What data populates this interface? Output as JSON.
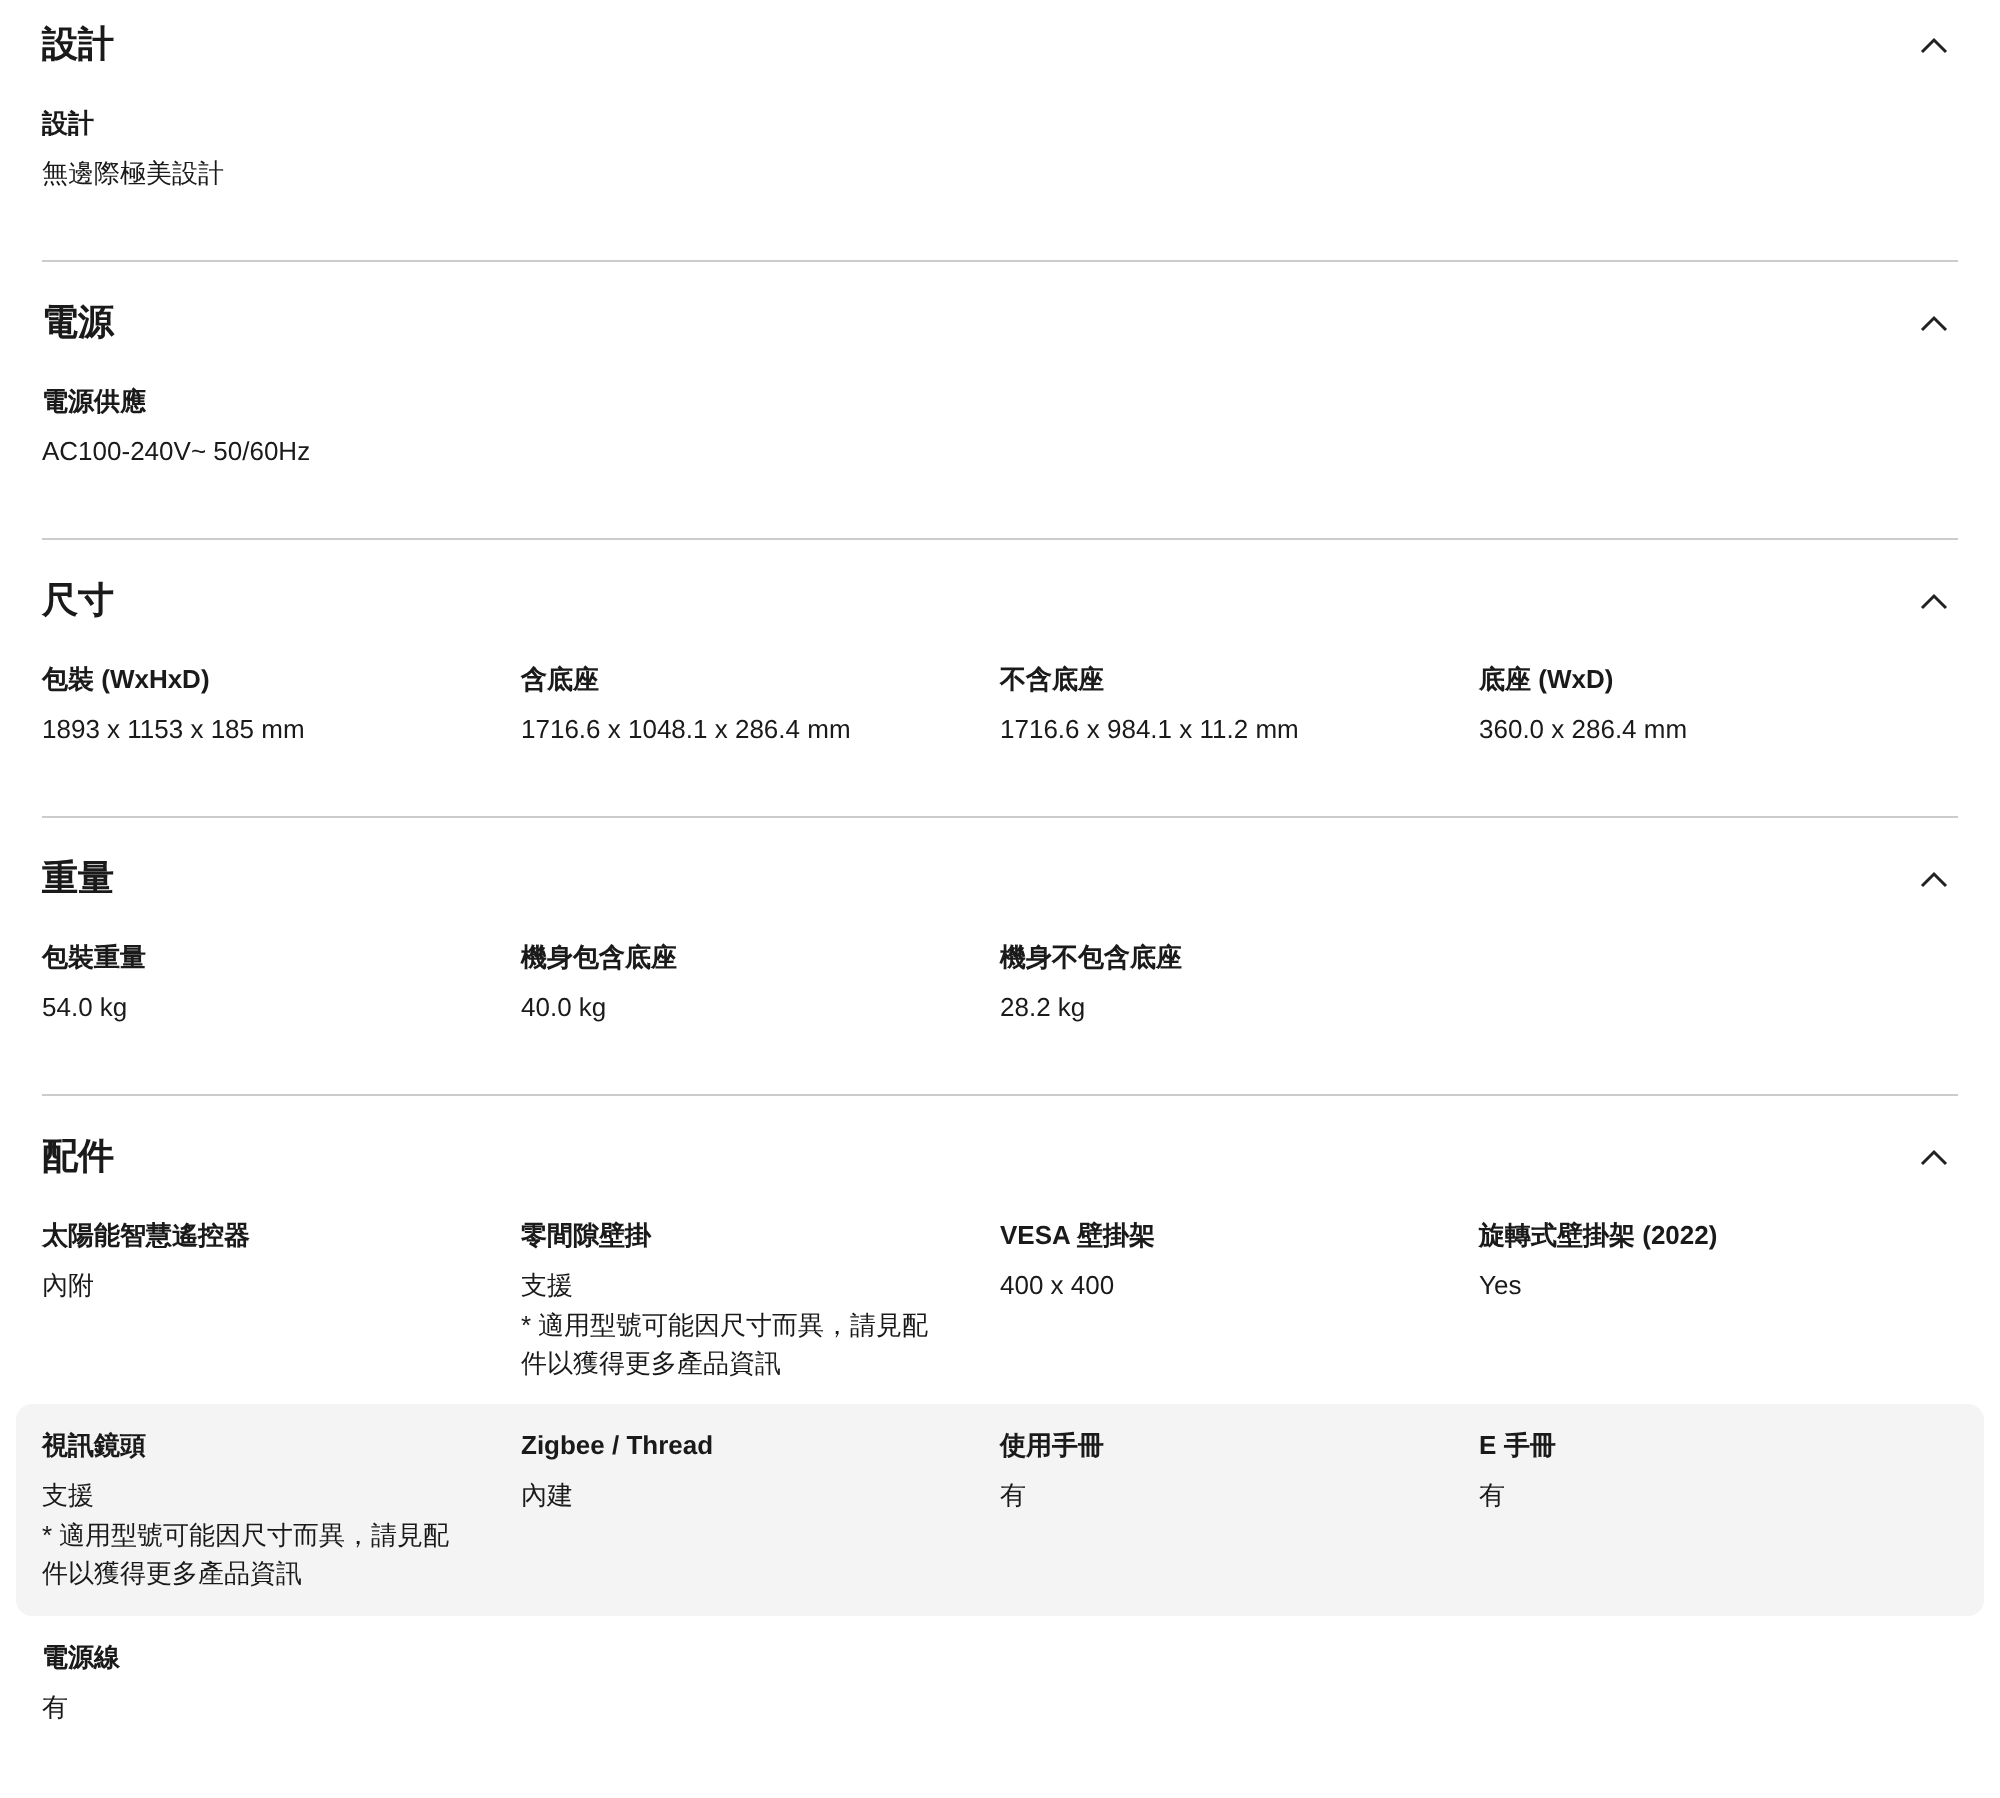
{
  "sections": [
    {
      "title": "設計",
      "expanded": true,
      "rows": [
        {
          "highlighted": false,
          "items": [
            {
              "label": "設計",
              "value": "無邊際極美設計"
            }
          ]
        }
      ]
    },
    {
      "title": "電源",
      "expanded": true,
      "rows": [
        {
          "highlighted": false,
          "items": [
            {
              "label": "電源供應",
              "value": "AC100-240V~ 50/60Hz"
            }
          ]
        }
      ]
    },
    {
      "title": "尺寸",
      "expanded": true,
      "rows": [
        {
          "highlighted": false,
          "items": [
            {
              "label": "包裝 (WxHxD)",
              "value": "1893 x 1153 x 185 mm"
            },
            {
              "label": "含底座",
              "value": "1716.6 x 1048.1 x 286.4 mm"
            },
            {
              "label": "不含底座",
              "value": "1716.6 x 984.1 x 11.2 mm"
            },
            {
              "label": "底座 (WxD)",
              "value": "360.0 x 286.4 mm"
            }
          ]
        }
      ]
    },
    {
      "title": "重量",
      "expanded": true,
      "rows": [
        {
          "highlighted": false,
          "items": [
            {
              "label": "包裝重量",
              "value": "54.0 kg"
            },
            {
              "label": "機身包含底座",
              "value": "40.0 kg"
            },
            {
              "label": "機身不包含底座",
              "value": "28.2 kg"
            }
          ]
        }
      ]
    },
    {
      "title": "配件",
      "expanded": true,
      "rows": [
        {
          "highlighted": false,
          "items": [
            {
              "label": "太陽能智慧遙控器",
              "value": "內附"
            },
            {
              "label": "零間隙壁掛",
              "value": "支援",
              "note": "* 適用型號可能因尺寸而異，請見配件以獲得更多產品資訊"
            },
            {
              "label": "VESA 壁掛架",
              "value": "400 x 400"
            },
            {
              "label": "旋轉式壁掛架 (2022)",
              "value": "Yes"
            }
          ]
        },
        {
          "highlighted": true,
          "items": [
            {
              "label": "視訊鏡頭",
              "value": "支援",
              "note": "* 適用型號可能因尺寸而異，請見配件以獲得更多產品資訊"
            },
            {
              "label": "Zigbee / Thread",
              "value": "內建"
            },
            {
              "label": "使用手冊",
              "value": "有"
            },
            {
              "label": "E 手冊",
              "value": "有"
            }
          ]
        },
        {
          "highlighted": false,
          "items": [
            {
              "label": "電源線",
              "value": "有"
            }
          ]
        }
      ]
    }
  ]
}
